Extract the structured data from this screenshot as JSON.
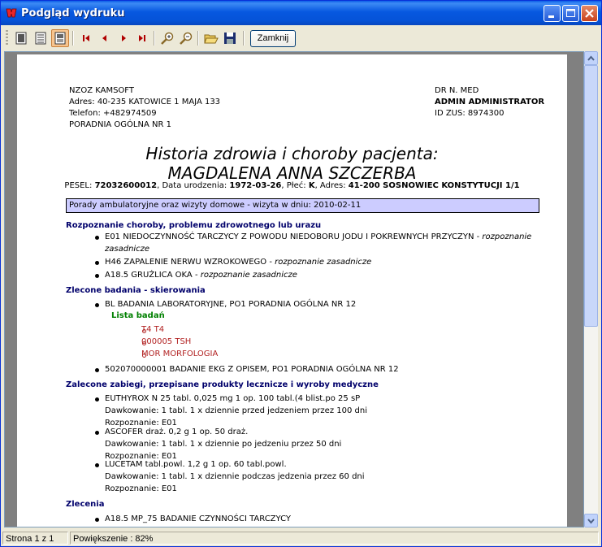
{
  "window": {
    "title": "Podgląd wydruku"
  },
  "toolbar": {
    "icons": [
      "single-page-icon",
      "multi-page-icon",
      "page-width-icon",
      "first-page-icon",
      "prev-page-icon",
      "next-page-icon",
      "last-page-icon",
      "zoom-in-icon",
      "zoom-out-icon",
      "open-icon",
      "save-icon"
    ],
    "close_label": "Zamknij"
  },
  "doc": {
    "hdr_left": [
      "NZOZ KAMSOFT",
      "Adres: 40-235 KATOWICE 1 MAJA 133",
      "Telefon: +482974509",
      "PORADNIA OGÓLNA NR 1"
    ],
    "hdr_right": [
      "DR N. MED",
      "ADMIN ADMINISTRATOR",
      "ID ZUS: 8974300"
    ],
    "title1": "Historia zdrowia i choroby pacjenta:",
    "title2": "MAGDALENA ANNA SZCZERBA",
    "pesel": {
      "l1": "PESEL: ",
      "v1": "72032600012",
      "l2": ", Data urodzenia: ",
      "v2": "1972-03-26",
      "l3": ", Płeć: ",
      "v3": "K",
      "l4": ", Adres: ",
      "v4": "41-200 SOSNOWIEC KONSTYTUCJI 1/1"
    },
    "visit": "Porady ambulatoryjne oraz wizyty domowe - wizyta w dniu: 2010-02-11",
    "s1": {
      "h": "Rozpoznanie choroby, problemu zdrowotnego lub urazu",
      "i1a": "E01 NIEDOCZYNNOŚĆ TARCZYCY Z POWODU NIEDOBORU JODU I POKREWNYCH PRZYCZYN - ",
      "i1b": "rozpoznanie",
      "i1c": "zasadnicze",
      "i2a": "H46 ZAPALENIE NERWU WZROKOWEGO - ",
      "i2b": "rozpoznanie zasadnicze",
      "i3a": "A18.5 GRUŹLICA OKA - ",
      "i3b": "rozpoznanie zasadnicze"
    },
    "s2": {
      "h": "Zlecone badania - skierowania",
      "i1": "BL BADANIA LABORATORYJNE, PO1 PORADNIA OGÓLNA NR 12",
      "list_label": "Lista badań",
      "tests": [
        "T4 T4",
        "000005 TSH",
        "MOR MORFOLOGIA"
      ],
      "i2": "502070000001 BADANIE EKG Z OPISEM, PO1 PORADNIA OGÓLNA NR 12"
    },
    "s3": {
      "h": "Zalecone zabiegi, przepisane produkty lecznicze i wyroby medyczne",
      "drugs": [
        {
          "name": "EUTHYROX N 25 tabl. 0,025 mg 1 op. 100 tabl.(4 blist.po 25 sP",
          "dose": "Dawkowanie: 1 tabl. 1 x dziennie przed jedzeniem przez 100 dni",
          "diag": "Rozpoznanie: E01"
        },
        {
          "name": "ASCOFER draż. 0,2 g 1 op. 50 draż.",
          "dose": "Dawkowanie: 1 tabl. 1 x dziennie po jedzeniu przez 50 dni",
          "diag": "Rozpoznanie: E01"
        },
        {
          "name": "LUCETAM tabl.powl. 1,2 g 1 op. 60 tabl.powl.",
          "dose": "Dawkowanie: 1 tabl. 1 x dziennie podczas jedzenia przez 60 dni",
          "diag": "Rozpoznanie: E01"
        }
      ]
    },
    "s4": {
      "h": "Zlecenia",
      "i1": "A18.5 MP_75 BADANIE CZYNNOŚCI TARCZYCY"
    }
  },
  "status": {
    "page": "Strona 1 z 1",
    "zoom": "Powiększenie : 82%"
  }
}
